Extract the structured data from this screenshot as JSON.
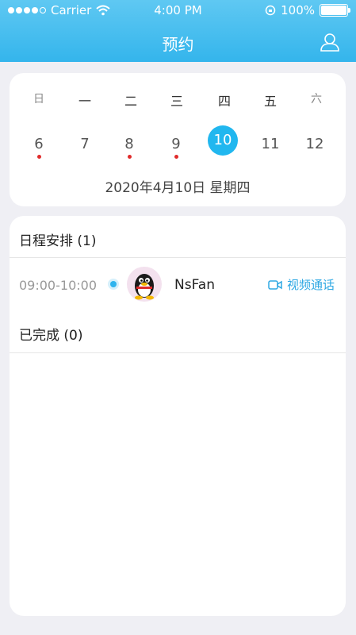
{
  "status_bar": {
    "carrier": "Carrier",
    "time": "4:00 PM",
    "battery": "100%"
  },
  "header": {
    "title": "预约",
    "user_icon": "user-icon"
  },
  "calendar": {
    "weekdays": [
      "日",
      "一",
      "二",
      "三",
      "四",
      "五",
      "六"
    ],
    "dates": [
      "6",
      "7",
      "8",
      "9",
      "10",
      "11",
      "12"
    ],
    "selected_index": 4,
    "marked_indices": [
      0,
      2,
      3
    ],
    "selected_text": "2020年4月10日  星期四",
    "accent": "#21b7ef",
    "mark_color": "#e02b2b"
  },
  "schedule": {
    "title": "日程安排 (1)",
    "items": [
      {
        "time": "09:00-10:00",
        "name": "NsFan",
        "action": "视频通话"
      }
    ]
  },
  "completed": {
    "title": "已完成 (0)"
  }
}
